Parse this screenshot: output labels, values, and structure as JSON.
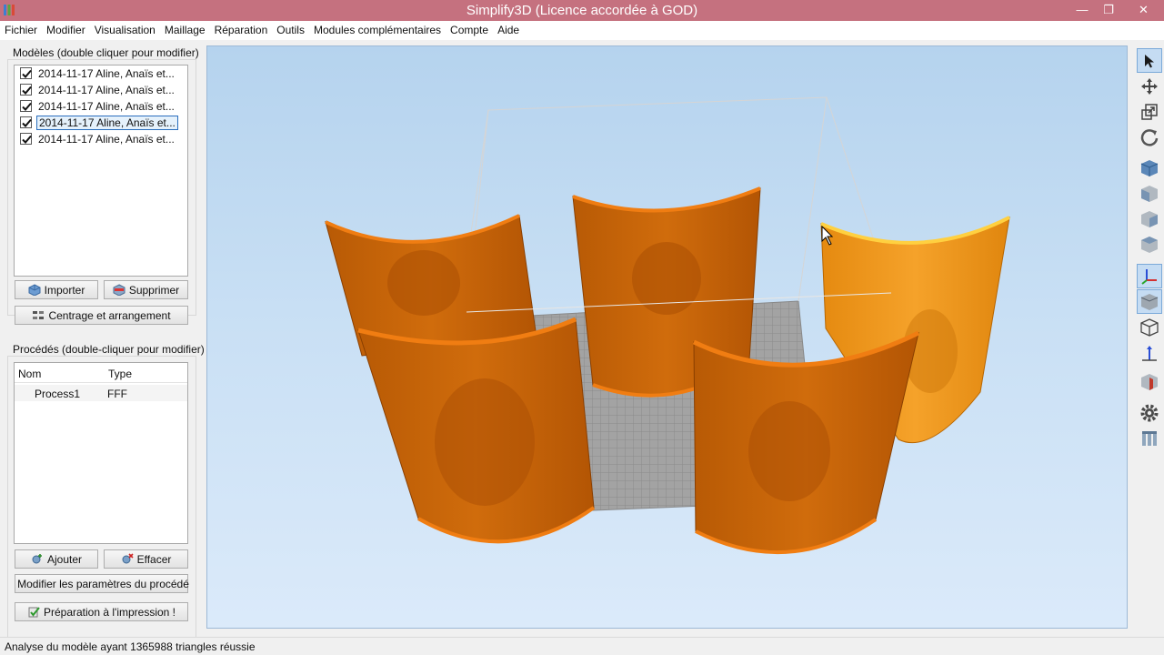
{
  "window": {
    "title": "Simplify3D (Licence accordée à GOD)",
    "minimize": "—",
    "maximize": "❐",
    "close": "✕"
  },
  "menu": [
    "Fichier",
    "Modifier",
    "Visualisation",
    "Maillage",
    "Réparation",
    "Outils",
    "Modules complémentaires",
    "Compte",
    "Aide"
  ],
  "models": {
    "title": "Modèles (double cliquer pour modifier)",
    "items": [
      {
        "label": "2014-11-17 Aline, Anaïs et...",
        "checked": true
      },
      {
        "label": "2014-11-17 Aline, Anaïs et...",
        "checked": true
      },
      {
        "label": "2014-11-17 Aline, Anaïs et...",
        "checked": true
      },
      {
        "label": "2014-11-17 Aline, Anaïs et...",
        "checked": true
      },
      {
        "label": "2014-11-17 Aline, Anaïs et...",
        "checked": true
      }
    ],
    "selected_index": 3,
    "import_label": "Importer",
    "delete_label": "Supprimer",
    "arrange_label": "Centrage et arrangement"
  },
  "processes": {
    "title": "Procédés (double-cliquer pour modifier)",
    "columns": [
      "Nom",
      "Type"
    ],
    "rows": [
      {
        "name": "Process1",
        "type": "FFF"
      }
    ],
    "add_label": "Ajouter",
    "remove_label": "Effacer",
    "edit_label": "Modifier les paramètres du procédé",
    "prepare_label": "Préparation à l'impression !"
  },
  "status": "Analyse du modèle ayant 1365988 triangles réussie",
  "toolbar_icons": [
    "select-icon",
    "move-icon",
    "scale-icon",
    "rotate-icon",
    "view-default-icon",
    "view-front-icon",
    "view-side-icon",
    "view-top-icon",
    "axes-icon",
    "solid-view-icon",
    "wireframe-view-icon",
    "normal-icon",
    "cross-section-icon",
    "settings-icon",
    "layers-icon"
  ],
  "colors": {
    "model": "#e07a10",
    "model_selected": "#f39c1a",
    "titlebar": "#c5717f",
    "viewport_top": "#b5d3ee"
  }
}
